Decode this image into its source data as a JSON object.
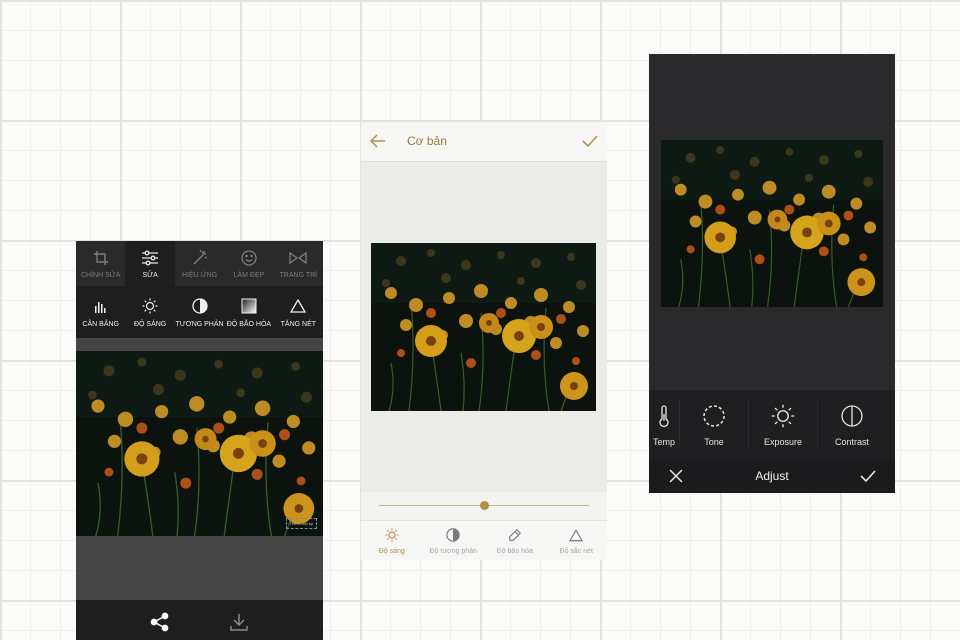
{
  "editor_dark": {
    "tabs": [
      {
        "label": "CHỈNH SỬA",
        "icon": "crop-icon"
      },
      {
        "label": "SỬA",
        "icon": "sliders-icon",
        "active": true
      },
      {
        "label": "HIỆU ỨNG",
        "icon": "magic-wand-icon"
      },
      {
        "label": "LÀM ĐẸP",
        "icon": "smile-icon"
      },
      {
        "label": "TRANG TRÍ",
        "icon": "bowtie-icon"
      }
    ],
    "tools": [
      {
        "label": "CÂN BẰNG",
        "icon": "histogram-icon"
      },
      {
        "label": "ĐỘ SÁNG",
        "icon": "sun-icon"
      },
      {
        "label": "TƯƠNG PHẢN",
        "icon": "contrast-icon"
      },
      {
        "label": "ĐỘ BÃO HÒA",
        "icon": "saturation-icon"
      },
      {
        "label": "TĂNG NÉT",
        "icon": "triangle-icon"
      }
    ],
    "watermark": "Thêm chữ ký",
    "bottom_actions": [
      {
        "label": "share",
        "icon": "share-icon"
      },
      {
        "label": "download",
        "icon": "download-icon"
      }
    ]
  },
  "editor_light": {
    "title": "Cơ bản",
    "back_icon": "arrow-left-icon",
    "confirm_icon": "check-icon",
    "slider_value": 0.5,
    "accent": "#b1904c",
    "tools": [
      {
        "label": "Độ sáng",
        "icon": "sun-icon",
        "active": true
      },
      {
        "label": "Độ tương phản",
        "icon": "contrast-icon"
      },
      {
        "label": "Độ bão hòa",
        "icon": "dropper-icon"
      },
      {
        "label": "Độ sắc nét",
        "icon": "triangle-icon"
      }
    ]
  },
  "editor_adjust": {
    "title": "Adjust",
    "tools": [
      {
        "label": "Temp",
        "icon": "thermometer-icon"
      },
      {
        "label": "Tone",
        "icon": "tone-icon"
      },
      {
        "label": "Exposure",
        "icon": "sun-icon"
      },
      {
        "label": "Contrast",
        "icon": "contrast-icon"
      }
    ],
    "cancel_icon": "close-icon",
    "confirm_icon": "check-icon"
  }
}
